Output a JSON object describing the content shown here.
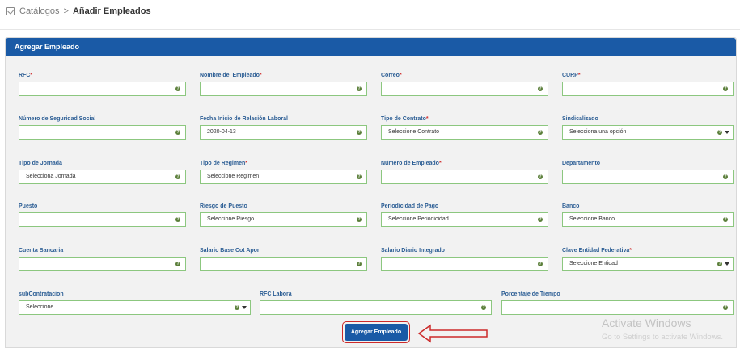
{
  "breadcrumb": {
    "parent": "Catálogos",
    "separator": ">",
    "current": "Añadir Empleados"
  },
  "panel": {
    "title": "Agregar Empleado"
  },
  "fields": {
    "rfc": {
      "label": "RFC",
      "req": "*",
      "value": ""
    },
    "nombre": {
      "label": "Nombre del Empleado",
      "req": "*",
      "value": ""
    },
    "correo": {
      "label": "Correo",
      "req": "*",
      "value": ""
    },
    "curp": {
      "label": "CURP",
      "req": "*",
      "value": ""
    },
    "nss": {
      "label": "Número de Seguridad Social",
      "value": ""
    },
    "fecha_inicio": {
      "label": "Fecha Inicio de Relación Laboral",
      "value": "2020-04-13"
    },
    "tipo_contrato": {
      "label": "Tipo de Contrato",
      "req": "*",
      "value": "Seleccione Contrato"
    },
    "sindicalizado": {
      "label": "Sindicalizado",
      "value": "Selecciona una opción"
    },
    "tipo_jornada": {
      "label": "Tipo de Jornada",
      "value": "Selecciona Jornada"
    },
    "tipo_regimen": {
      "label": "Tipo de Regimen",
      "req": "*",
      "value": "Seleccione Regimen"
    },
    "num_empleado": {
      "label": "Número de Empleado",
      "req": "*",
      "value": ""
    },
    "departamento": {
      "label": "Departamento",
      "value": ""
    },
    "puesto": {
      "label": "Puesto",
      "value": ""
    },
    "riesgo_puesto": {
      "label": "Riesgo de Puesto",
      "value": "Seleccione Riesgo"
    },
    "periodicidad": {
      "label": "Periodicidad de Pago",
      "value": "Seleccione Periodicidad"
    },
    "banco": {
      "label": "Banco",
      "value": "Seleccione Banco"
    },
    "cuenta_bancaria": {
      "label": "Cuenta Bancaria",
      "value": ""
    },
    "salario_base": {
      "label": "Salario Base Cot Apor",
      "value": ""
    },
    "salario_diario": {
      "label": "Salario Diario Integrado",
      "value": ""
    },
    "clave_entidad": {
      "label": "Clave Entidad Federativa",
      "req": "*",
      "value": "Seleccione Entidad"
    },
    "subcontratacion": {
      "label": "subContratacion",
      "value": "Seleccione"
    },
    "rfc_labora": {
      "label": "RFC Labora",
      "value": ""
    },
    "porcentaje_tiempo": {
      "label": "Porcentaje de Tiempo",
      "value": ""
    }
  },
  "submit": {
    "label": "Agregar Empleado"
  },
  "watermark": {
    "title": "Activate Windows",
    "subtitle": "Go to Settings to activate Windows."
  },
  "colors": {
    "header": "#1a5aa6",
    "field_border": "#8cc77f",
    "highlight": "#cc2a2a"
  }
}
